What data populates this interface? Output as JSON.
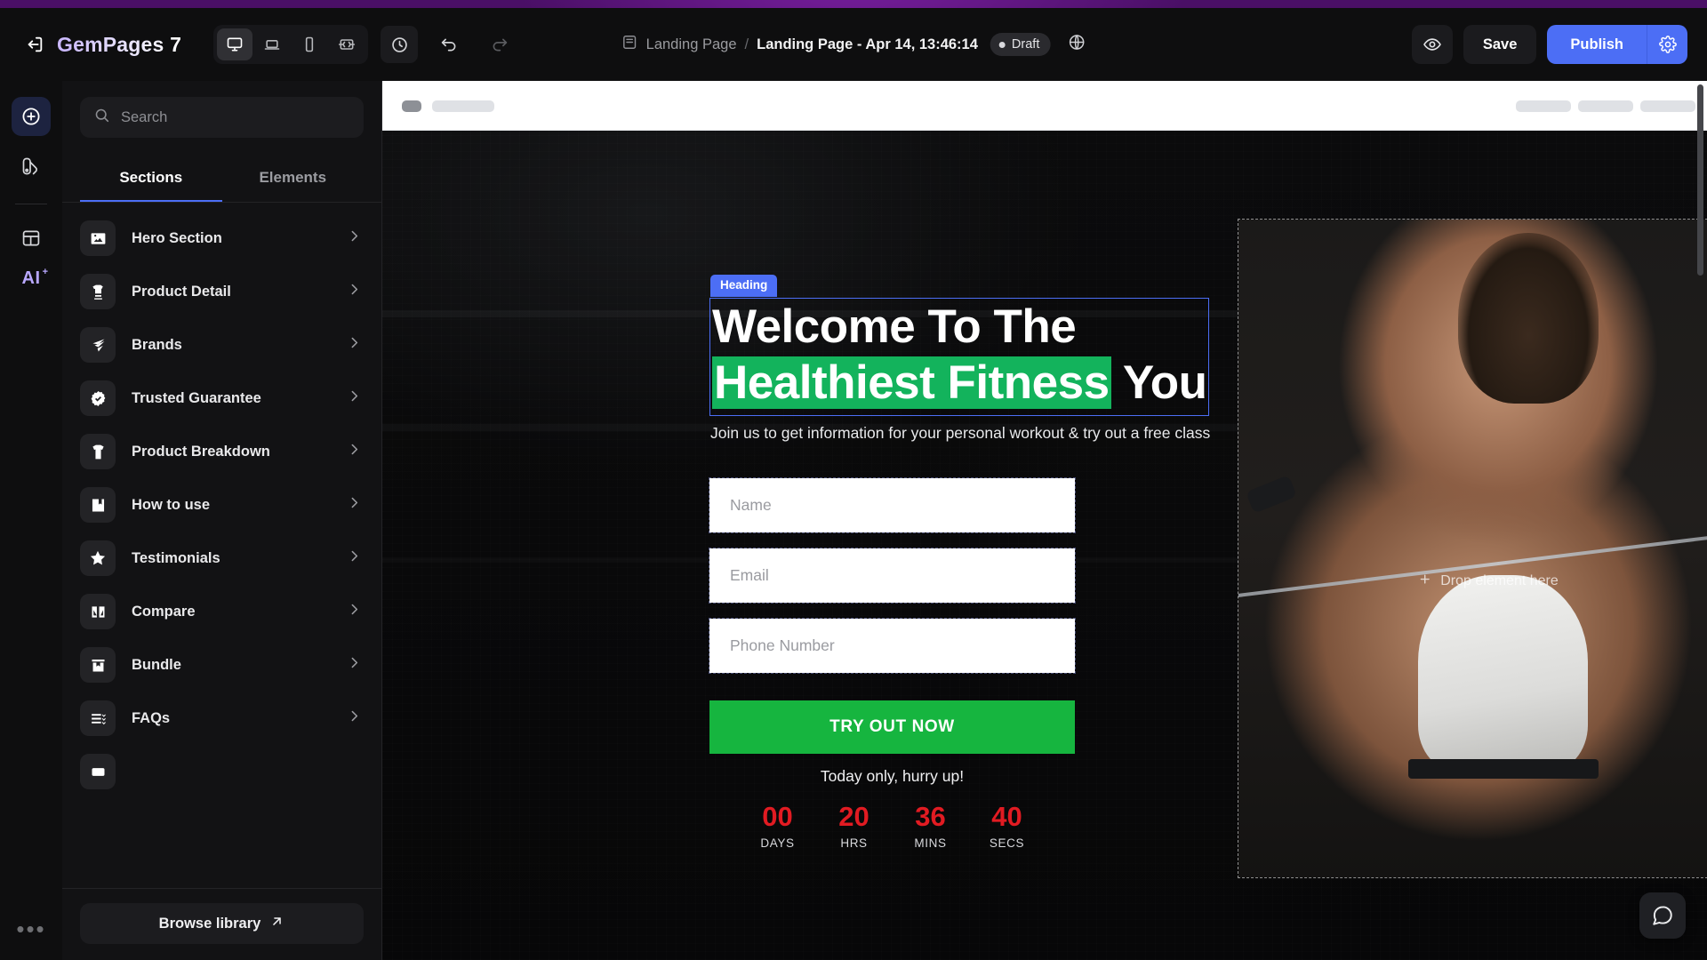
{
  "topbar": {
    "exit_icon": "exit-icon",
    "brand": "GemPages 7",
    "devices": [
      {
        "name": "desktop",
        "icon": "desktop-icon",
        "active": true
      },
      {
        "name": "laptop",
        "icon": "laptop-icon",
        "active": false
      },
      {
        "name": "mobile",
        "icon": "mobile-icon",
        "active": false
      },
      {
        "name": "responsive",
        "icon": "responsive-icon",
        "active": false
      }
    ],
    "history_icon": "history-clock-icon",
    "undo_icon": "undo-icon",
    "redo_icon": "redo-icon",
    "breadcrumb": {
      "doc_icon": "page-doc-icon",
      "root": "Landing Page",
      "separator": "/",
      "current": "Landing Page - Apr 14, 13:46:14",
      "status": "Draft",
      "globe_icon": "globe-icon"
    },
    "preview_icon": "eye-preview-icon",
    "save_label": "Save",
    "publish_label": "Publish",
    "publish_settings_icon": "gear-icon"
  },
  "rail": {
    "items": [
      {
        "name": "add",
        "icon": "plus-circle-icon",
        "active": true
      },
      {
        "name": "theme",
        "icon": "palette-icon",
        "active": false
      },
      {
        "name": "layout",
        "icon": "layout-icon",
        "active": false
      }
    ],
    "ai_label": "AI",
    "ai_sup": "+",
    "more_label": "•••"
  },
  "panel": {
    "search": {
      "placeholder": "Search",
      "value": "",
      "icon": "search-icon"
    },
    "tabs": [
      {
        "label": "Sections",
        "active": true
      },
      {
        "label": "Elements",
        "active": false
      }
    ],
    "sections": [
      {
        "label": "Hero Section",
        "icon": "image-icon"
      },
      {
        "label": "Product Detail",
        "icon": "shirt-detail-icon"
      },
      {
        "label": "Brands",
        "icon": "brands-flag-icon"
      },
      {
        "label": "Trusted Guarantee",
        "icon": "badge-check-icon"
      },
      {
        "label": "Product Breakdown",
        "icon": "tshirt-icon"
      },
      {
        "label": "How to use",
        "icon": "book-bookmark-icon"
      },
      {
        "label": "Testimonials",
        "icon": "star-icon"
      },
      {
        "label": "Compare",
        "icon": "compare-icon"
      },
      {
        "label": "Bundle",
        "icon": "bundle-box-icon"
      },
      {
        "label": "FAQs",
        "icon": "faq-list-icon"
      }
    ],
    "browse_label": "Browse library",
    "browse_icon": "arrow-up-right-icon"
  },
  "canvas": {
    "selected_element_badge": "Heading",
    "hero": {
      "heading_line1": "Welcome To The",
      "heading_highlight": "Healthiest Fitness",
      "heading_tail": "You",
      "subtitle": "Join us to get information for your personal workout & try out a free class",
      "fields": [
        {
          "placeholder": "Name"
        },
        {
          "placeholder": "Email"
        },
        {
          "placeholder": "Phone Number"
        }
      ],
      "cta_label": "TRY OUT NOW",
      "hurry_text": "Today only, hurry up!",
      "timer": [
        {
          "value": "00",
          "label": "DAYS"
        },
        {
          "value": "20",
          "label": "HRS"
        },
        {
          "value": "36",
          "label": "MINS"
        },
        {
          "value": "40",
          "label": "SECS"
        }
      ],
      "drop_hint": "Drop element here",
      "drop_icon": "plus-icon"
    }
  },
  "chat_icon": "chat-bubble-icon",
  "colors": {
    "accent_blue": "#4c6ef5",
    "highlight_green": "#13b35c",
    "cta_green": "#16b53f",
    "timer_red": "#e11b22",
    "panel_bg": "#121214",
    "topbar_bg": "#0e0e0f"
  }
}
